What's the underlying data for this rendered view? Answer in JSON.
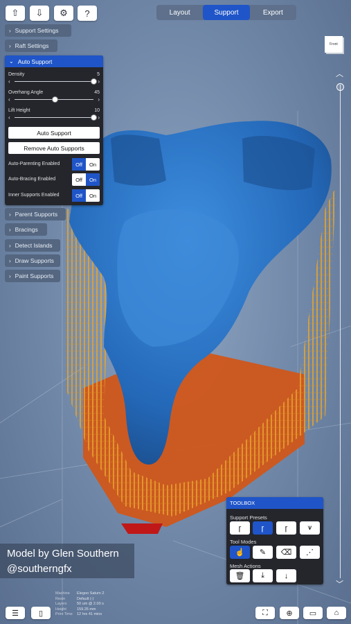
{
  "top_icons": [
    "upload-icon",
    "download-icon",
    "settings-icon",
    "help-icon"
  ],
  "top_icon_glyphs": {
    "help": "?"
  },
  "tabs": [
    {
      "label": "Layout",
      "active": false
    },
    {
      "label": "Support",
      "active": true
    },
    {
      "label": "Export",
      "active": false
    }
  ],
  "sidebar": {
    "support_settings": "Support Settings",
    "raft_settings": "Raft Settings",
    "auto_support": "Auto Support",
    "parent_supports": "Parent Supports",
    "bracings": "Bracings",
    "detect_islands": "Detect Islands",
    "draw_supports": "Draw Supports",
    "paint_supports": "Paint Supports"
  },
  "auto_support": {
    "density": {
      "label": "Density",
      "value": "5",
      "fraction": 1.0
    },
    "overhang": {
      "label": "Overhang Angle",
      "value": "45",
      "fraction": 0.5
    },
    "lift_height": {
      "label": "Lift Height",
      "value": "10",
      "fraction": 1.0
    },
    "auto_support_btn": "Auto Support",
    "remove_btn": "Remove Auto Supports",
    "toggles": [
      {
        "label": "Auto-Parenting Enabled",
        "off": "Off",
        "on": "On",
        "state": "off"
      },
      {
        "label": "Auto-Bracing Enabled",
        "off": "Off",
        "on": "On",
        "state": "on"
      },
      {
        "label": "Inner Supports Enabled",
        "off": "Off",
        "on": "On",
        "state": "off"
      }
    ]
  },
  "view_cube_label": "Front",
  "credit": {
    "line1": "Model by Glen Southern",
    "line2": "@southerngfx"
  },
  "toolbox": {
    "title": "TOOLBOX",
    "presets_label": "Support Presets",
    "tool_modes_label": "Tool Modes",
    "mesh_actions_label": "Mesh Actions",
    "presets_active": 1,
    "tool_modes_active": 0
  },
  "info": [
    {
      "key": "Machine",
      "value": "Elegoo Saturn 2"
    },
    {
      "key": "Resin",
      "value": "Default (-)"
    },
    {
      "key": "Layers",
      "value": "50 um @ 2.00 s"
    },
    {
      "key": "Height",
      "value": "159.26 mm"
    },
    {
      "key": "Print Time",
      "value": "12 hrs 41 mins"
    }
  ],
  "bottom_left_icons": [
    "menu-icon",
    "tablet-icon"
  ],
  "bottom_right_icons": [
    "fullscreen-icon",
    "target-icon",
    "camera-icon",
    "home-icon"
  ],
  "colors": {
    "accent": "#1f55c8",
    "model": "#2f7bd0",
    "supports": "#e6a32a",
    "raft": "#d0561a"
  }
}
